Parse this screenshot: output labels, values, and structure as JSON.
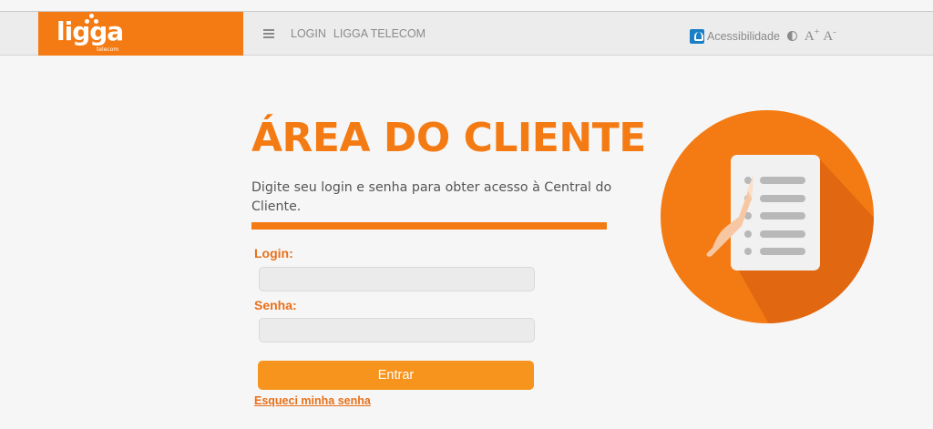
{
  "header": {
    "logo_text": "ligga",
    "logo_sub": "telecom",
    "nav": [
      "LOGIN",
      "LIGGA TELECOM"
    ],
    "accessibility_label": "Acessibilidade",
    "font_increase": "A",
    "font_increase_mark": "+",
    "font_decrease": "A",
    "font_decrease_mark": "-"
  },
  "main": {
    "title": "ÁREA DO CLIENTE",
    "intro": "Digite seu login e senha para obter acesso à Central do Cliente.",
    "login_label": "Login:",
    "login_value": "",
    "password_label": "Senha:",
    "password_value": "",
    "submit_label": "Entrar",
    "forgot_label": "Esqueci minha senha"
  },
  "colors": {
    "brand_orange": "#f47b13",
    "button_orange": "#f7941d",
    "accessibility_blue": "#1a7fc4"
  },
  "icons": [
    "menu-icon",
    "accessibility-icon",
    "contrast-icon",
    "document-click-illustration"
  ]
}
